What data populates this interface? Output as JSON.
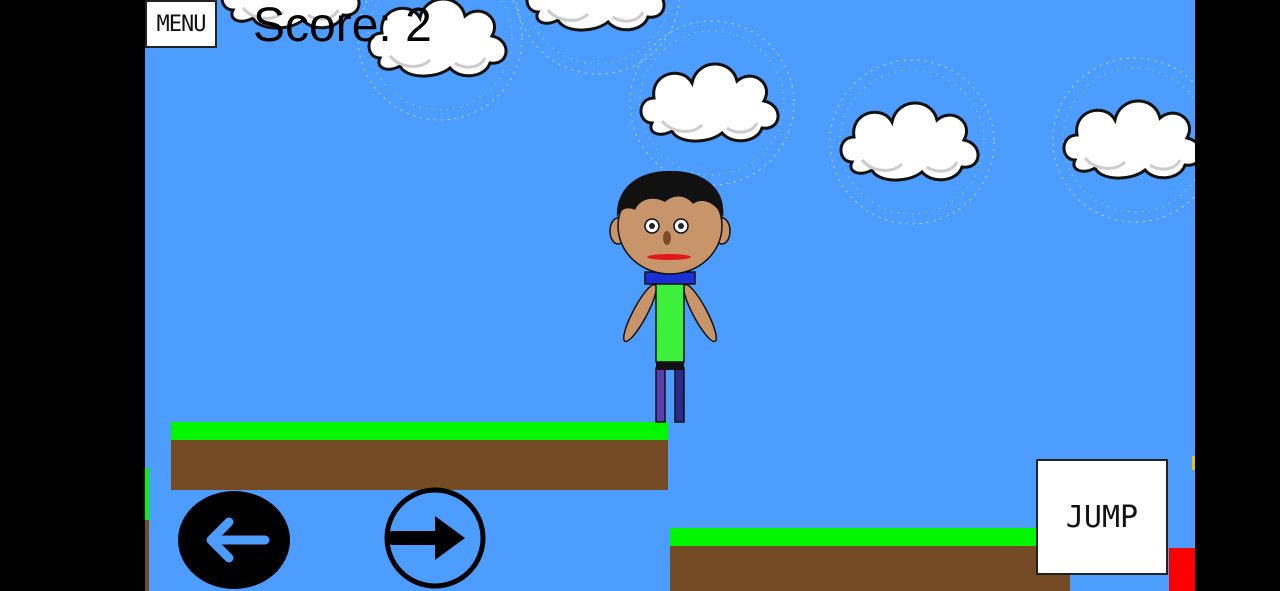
{
  "hud": {
    "menu_label": "MENU",
    "score_label": "Score:",
    "score_value": "2"
  },
  "controls": {
    "jump_label": "JUMP",
    "left_icon": "arrow-left-icon",
    "right_icon": "arrow-right-icon"
  },
  "colors": {
    "sky": "#4c9dff",
    "grass": "#00f700",
    "dirt": "#754b25",
    "hazard": "#ff0000",
    "shirt": "#3cf03c",
    "scarf": "#1a2ed6",
    "pants": "#4a3a9a",
    "skin": "#c8946a"
  }
}
